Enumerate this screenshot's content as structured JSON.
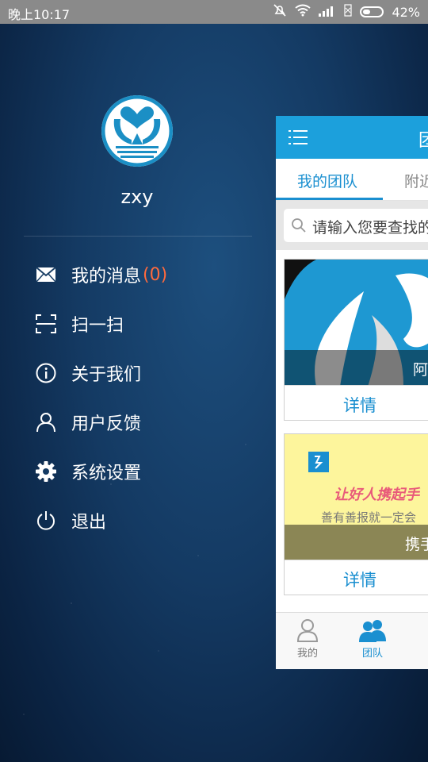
{
  "status_bar": {
    "time": "晚上10:17",
    "battery": "42%",
    "battery_level": 0.42
  },
  "drawer": {
    "username": "zxy",
    "menu": [
      {
        "label": "我的消息",
        "count": "(0)",
        "icon": "mail-icon"
      },
      {
        "label": "扫一扫",
        "icon": "scan-icon"
      },
      {
        "label": "关于我们",
        "icon": "info-icon"
      },
      {
        "label": "用户反馈",
        "icon": "user-icon"
      },
      {
        "label": "系统设置",
        "icon": "gear-icon"
      },
      {
        "label": "退出",
        "icon": "power-icon"
      }
    ]
  },
  "main": {
    "title_partial": "团",
    "tabs": [
      {
        "label": "我的团队",
        "active": true
      },
      {
        "label": "附近"
      }
    ],
    "search_placeholder": "请输入您要查找的",
    "cards": [
      {
        "caption": "阿",
        "button": "详情"
      },
      {
        "title": "让好人携起手",
        "subtitle": "善有善报就一定会",
        "caption": "携手",
        "button": "详情"
      }
    ],
    "bottom_nav": [
      {
        "label": "我的",
        "icon": "person-icon"
      },
      {
        "label": "团队",
        "icon": "team-icon",
        "active": true
      },
      {
        "label": "",
        "icon": "partial-icon"
      }
    ]
  },
  "colors": {
    "accent": "#1ca0dc",
    "count": "#ff6a3d",
    "card_yellow": "#fdf59c"
  }
}
